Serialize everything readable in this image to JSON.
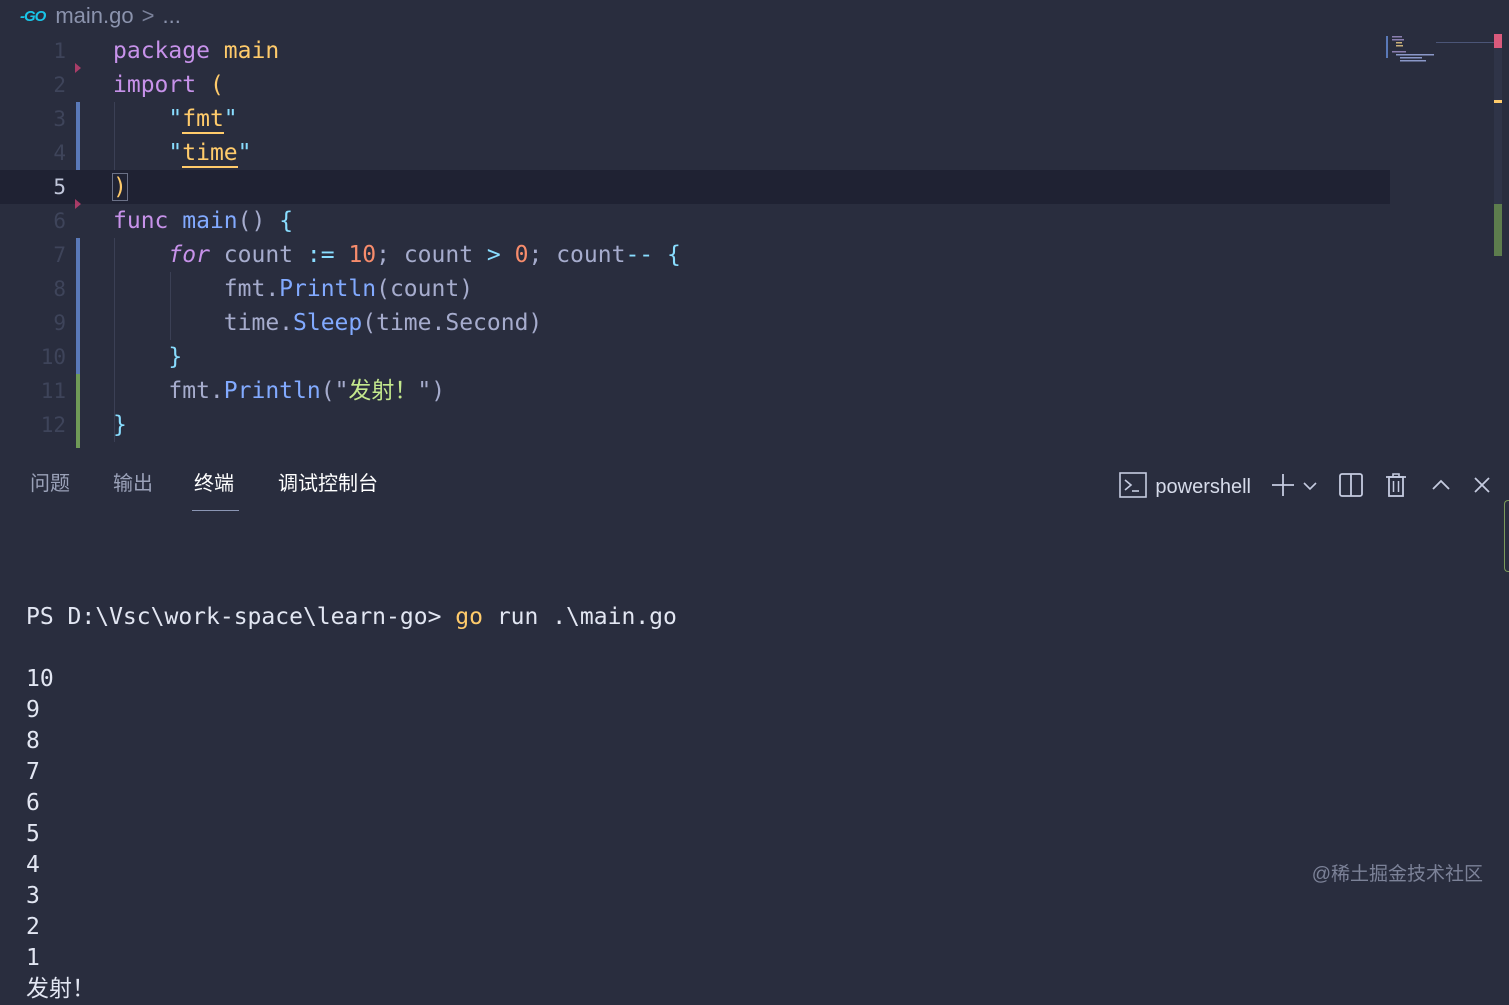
{
  "breadcrumb": {
    "lang_badge": "-GO",
    "file": "main.go",
    "separator": ">",
    "more": "..."
  },
  "editor": {
    "line_numbers": [
      "1",
      "2",
      "3",
      "4",
      "5",
      "6",
      "7",
      "8",
      "9",
      "10",
      "11",
      "12"
    ],
    "lines": [
      [
        {
          "t": "package",
          "c": "k"
        },
        {
          "t": " ",
          "c": "pl"
        },
        {
          "t": "main",
          "c": "y"
        }
      ],
      [
        {
          "t": "import",
          "c": "k"
        },
        {
          "t": " ",
          "c": "pl"
        },
        {
          "t": "(",
          "c": "y"
        }
      ],
      [
        {
          "t": "    ",
          "c": "pl"
        },
        {
          "t": "\"",
          "c": "op"
        },
        {
          "t": "fmt",
          "c": "imp"
        },
        {
          "t": "\"",
          "c": "op"
        }
      ],
      [
        {
          "t": "    ",
          "c": "pl"
        },
        {
          "t": "\"",
          "c": "op"
        },
        {
          "t": "time",
          "c": "imp"
        },
        {
          "t": "\"",
          "c": "op"
        }
      ],
      [
        {
          "t": ")",
          "c": "y"
        }
      ],
      [
        {
          "t": "func",
          "c": "k"
        },
        {
          "t": " ",
          "c": "pl"
        },
        {
          "t": "main",
          "c": "fn"
        },
        {
          "t": "()",
          "c": "pl"
        },
        {
          "t": " ",
          "c": "pl"
        },
        {
          "t": "{",
          "c": "op"
        }
      ],
      [
        {
          "t": "    ",
          "c": "pl"
        },
        {
          "t": "for",
          "c": "kf"
        },
        {
          "t": " count ",
          "c": "pl"
        },
        {
          "t": ":=",
          "c": "op"
        },
        {
          "t": " ",
          "c": "pl"
        },
        {
          "t": "10",
          "c": "nm"
        },
        {
          "t": "; count ",
          "c": "pl"
        },
        {
          "t": ">",
          "c": "op"
        },
        {
          "t": " ",
          "c": "pl"
        },
        {
          "t": "0",
          "c": "nm"
        },
        {
          "t": "; count",
          "c": "pl"
        },
        {
          "t": "--",
          "c": "op"
        },
        {
          "t": " ",
          "c": "pl"
        },
        {
          "t": "{",
          "c": "op"
        }
      ],
      [
        {
          "t": "        fmt.",
          "c": "pl"
        },
        {
          "t": "Println",
          "c": "fn"
        },
        {
          "t": "(count)",
          "c": "pl"
        }
      ],
      [
        {
          "t": "        time.",
          "c": "pl"
        },
        {
          "t": "Sleep",
          "c": "fn"
        },
        {
          "t": "(time.Second)",
          "c": "pl"
        }
      ],
      [
        {
          "t": "    ",
          "c": "pl"
        },
        {
          "t": "}",
          "c": "op"
        }
      ],
      [
        {
          "t": "    fmt.",
          "c": "pl"
        },
        {
          "t": "Println",
          "c": "fn"
        },
        {
          "t": "(\"",
          "c": "pl"
        },
        {
          "t": "发射！",
          "c": "st"
        },
        {
          "t": "\")",
          "c": "pl"
        }
      ],
      [
        {
          "t": "}",
          "c": "op"
        }
      ]
    ]
  },
  "panel": {
    "tabs": [
      "问题",
      "输出",
      "终端",
      "调试控制台"
    ],
    "active_tab": "终端",
    "shell_label": "powershell"
  },
  "terminal": {
    "prompt": "PS D:\\Vsc\\work-space\\learn-go> ",
    "command": "go",
    "args": " run .\\main.go",
    "output": [
      "10",
      "9",
      "8",
      "7",
      "6",
      "5",
      "4",
      "3",
      "2",
      "1",
      "发射！"
    ]
  },
  "watermark": "@稀土掘金技术社区",
  "colors": {
    "background": "#292d3e",
    "keyword": "#c792ea",
    "function": "#82aaff",
    "string": "#c3e88d",
    "number": "#f78c6c",
    "accent": "#ffcb6b"
  }
}
